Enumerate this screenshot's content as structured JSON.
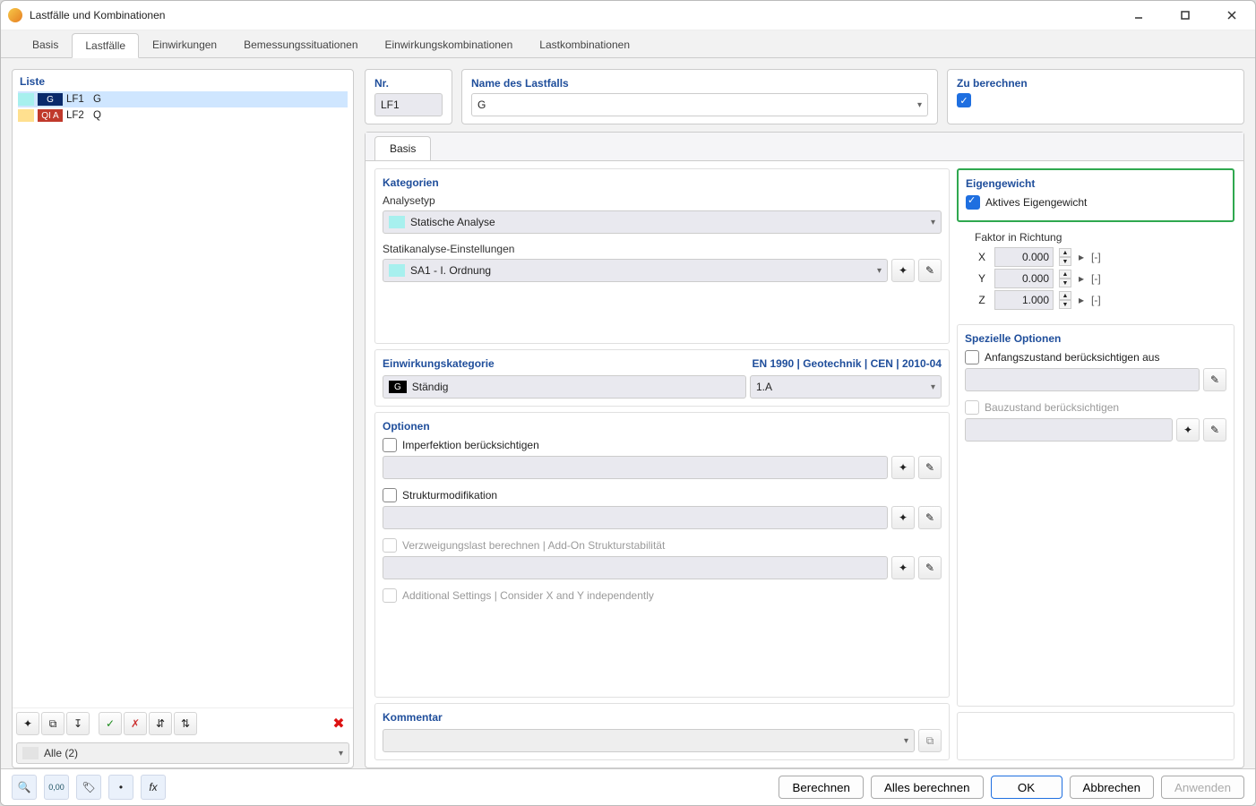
{
  "window": {
    "title": "Lastfälle und Kombinationen"
  },
  "tabs": [
    "Basis",
    "Lastfälle",
    "Einwirkungen",
    "Bemessungssituationen",
    "Einwirkungskombinationen",
    "Lastkombinationen"
  ],
  "activeTab": 1,
  "left": {
    "listLabel": "Liste",
    "items": [
      {
        "swatch": "#a7f0ee",
        "tag": "G",
        "tagBg": "#0a2a6b",
        "id": "LF1",
        "name": "G",
        "selected": true
      },
      {
        "swatch": "#ffe08f",
        "tag": "QI A",
        "tagBg": "#c0392b",
        "id": "LF2",
        "name": "Q",
        "selected": false
      }
    ],
    "filter": "Alle (2)"
  },
  "header": {
    "nrLabel": "Nr.",
    "nrValue": "LF1",
    "nameLabel": "Name des Lastfalls",
    "nameValue": "G",
    "calcLabel": "Zu berechnen"
  },
  "subtab": "Basis",
  "kategorien": {
    "title": "Kategorien",
    "analyseLabel": "Analysetyp",
    "analyseValue": "Statische Analyse",
    "statikLabel": "Statikanalyse-Einstellungen",
    "statikValue": "SA1 - I. Ordnung"
  },
  "einwirkung": {
    "title": "Einwirkungskategorie",
    "stdText": "EN 1990 | Geotechnik | CEN | 2010-04",
    "tag": "G",
    "value": "Ständig",
    "rightValue": "1.A"
  },
  "optionen": {
    "title": "Optionen",
    "o1": "Imperfektion berücksichtigen",
    "o2": "Strukturmodifikation",
    "o3": "Verzweigungslast berechnen | Add-On Strukturstabilität",
    "o4": "Additional Settings | Consider X and Y independently"
  },
  "eigengewicht": {
    "title": "Eigengewicht",
    "aktiv": "Aktives Eigengewicht",
    "faktor": "Faktor in Richtung",
    "x": "0.000",
    "y": "0.000",
    "z": "1.000",
    "unit": "[-]"
  },
  "spezielle": {
    "title": "Spezielle Optionen",
    "s1": "Anfangszustand berücksichtigen aus",
    "s2": "Bauzustand berücksichtigen"
  },
  "kommentar": {
    "title": "Kommentar"
  },
  "footer": {
    "berechnen": "Berechnen",
    "alles": "Alles berechnen",
    "ok": "OK",
    "abbrechen": "Abbrechen",
    "anwenden": "Anwenden"
  }
}
